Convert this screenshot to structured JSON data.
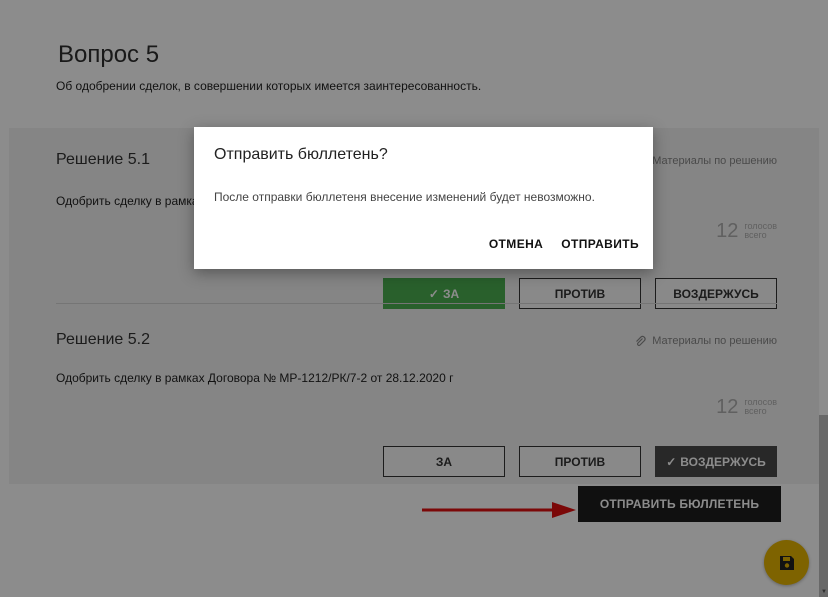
{
  "question": {
    "title": "Вопрос 5",
    "description": "Об одобрении сделок, в совершении которых имеется заинтересованность."
  },
  "decisions": [
    {
      "title": "Решение 5.1",
      "text": "Одобрить сделку в рамках Договора № МР-1212/РК/7-2 от 28.12.2020 г",
      "materials_label": "Материалы по решению",
      "votes_count": "12",
      "votes_label_1": "голосов",
      "votes_label_2": "всего",
      "btn_for": "ЗА",
      "btn_against": "ПРОТИВ",
      "btn_abstain": "ВОЗДЕРЖУСЬ",
      "selected": "for"
    },
    {
      "title": "Решение 5.2",
      "text": "Одобрить сделку в рамках Договора № МР-1212/РК/7-2 от 28.12.2020 г",
      "materials_label": "Материалы по решению",
      "votes_count": "12",
      "votes_label_1": "голосов",
      "votes_label_2": "всего",
      "btn_for": "ЗА",
      "btn_against": "ПРОТИВ",
      "btn_abstain": "ВОЗДЕРЖУСЬ",
      "selected": "abstain"
    }
  ],
  "submit_label": "ОТПРАВИТЬ БЮЛЛЕТЕНЬ",
  "check_mark": "✓",
  "dialog": {
    "title": "Отправить бюллетень?",
    "text": "После отправки бюллетеня внесение изменений будет невозможно.",
    "cancel": "ОТМЕНА",
    "confirm": "ОТПРАВИТЬ"
  },
  "icons": {
    "materials": "paperclip-icon",
    "fab": "save-icon",
    "annotation": "red-arrow"
  },
  "colors": {
    "green": "#4caf50",
    "dark": "#4a4a4a",
    "fab": "#e6b400",
    "arrow": "#e01010"
  }
}
